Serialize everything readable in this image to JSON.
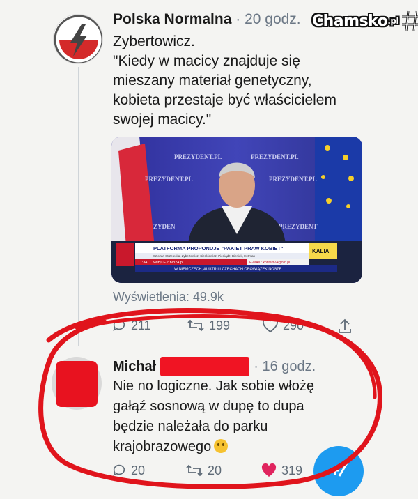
{
  "tweet": {
    "author": "Polska Normalna",
    "meta": "· 20 godz.",
    "lines": [
      "Zybertowicz.",
      "\"Kiedy w macicy znajduje się",
      "mieszany materiał genetyczny,",
      "kobieta przestaje być właścicielem",
      "swojej macicy.\""
    ],
    "views": "Wyświetlenia: 49.9k",
    "actions": {
      "replies": "211",
      "retweets": "199",
      "likes": "290"
    },
    "video": {
      "backdrop": [
        "PREZYDENT.PL",
        "PREZYDENT.PL",
        "PREZYDENT.PL",
        "PREZYDENT.PL",
        "PREZYDENT",
        "ZYDEN"
      ],
      "ticker_headline": "PLATFORMA PROPONUJE \"PAKIET PRAW KOBIET\"",
      "ticker_names": "Szłozar, Strzelecka, Zybertowicz, Sienkiewicz, Pieniądz, Bieniek, Hetman",
      "ticker_time": "11:34",
      "ticker_info": "WIĘCEJ: tvn24.pl",
      "ticker_email": "E-MAIL: kontakt24@tvn.pl",
      "ticker_news": "W NIEMCZECH, AUSTRII I CZECHACH OBOWIĄZEK NOSZE",
      "channel_logo": "KALIA"
    }
  },
  "reply": {
    "author": "Michał",
    "meta": "· 16 godz.",
    "lines": [
      "Nie no logiczne. Jak sobie włożę",
      "gałąź sosnową w dupę to dupa",
      "będzie należała do parku",
      "krajobrazowego"
    ],
    "actions": {
      "replies": "20",
      "retweets": "20",
      "likes": "319"
    }
  },
  "watermark": {
    "text": "Chamsko",
    "suffix": ".pl"
  },
  "colors": {
    "accent": "#1d9bf0",
    "scribble": "#e0141c",
    "like": "#e0245e"
  }
}
